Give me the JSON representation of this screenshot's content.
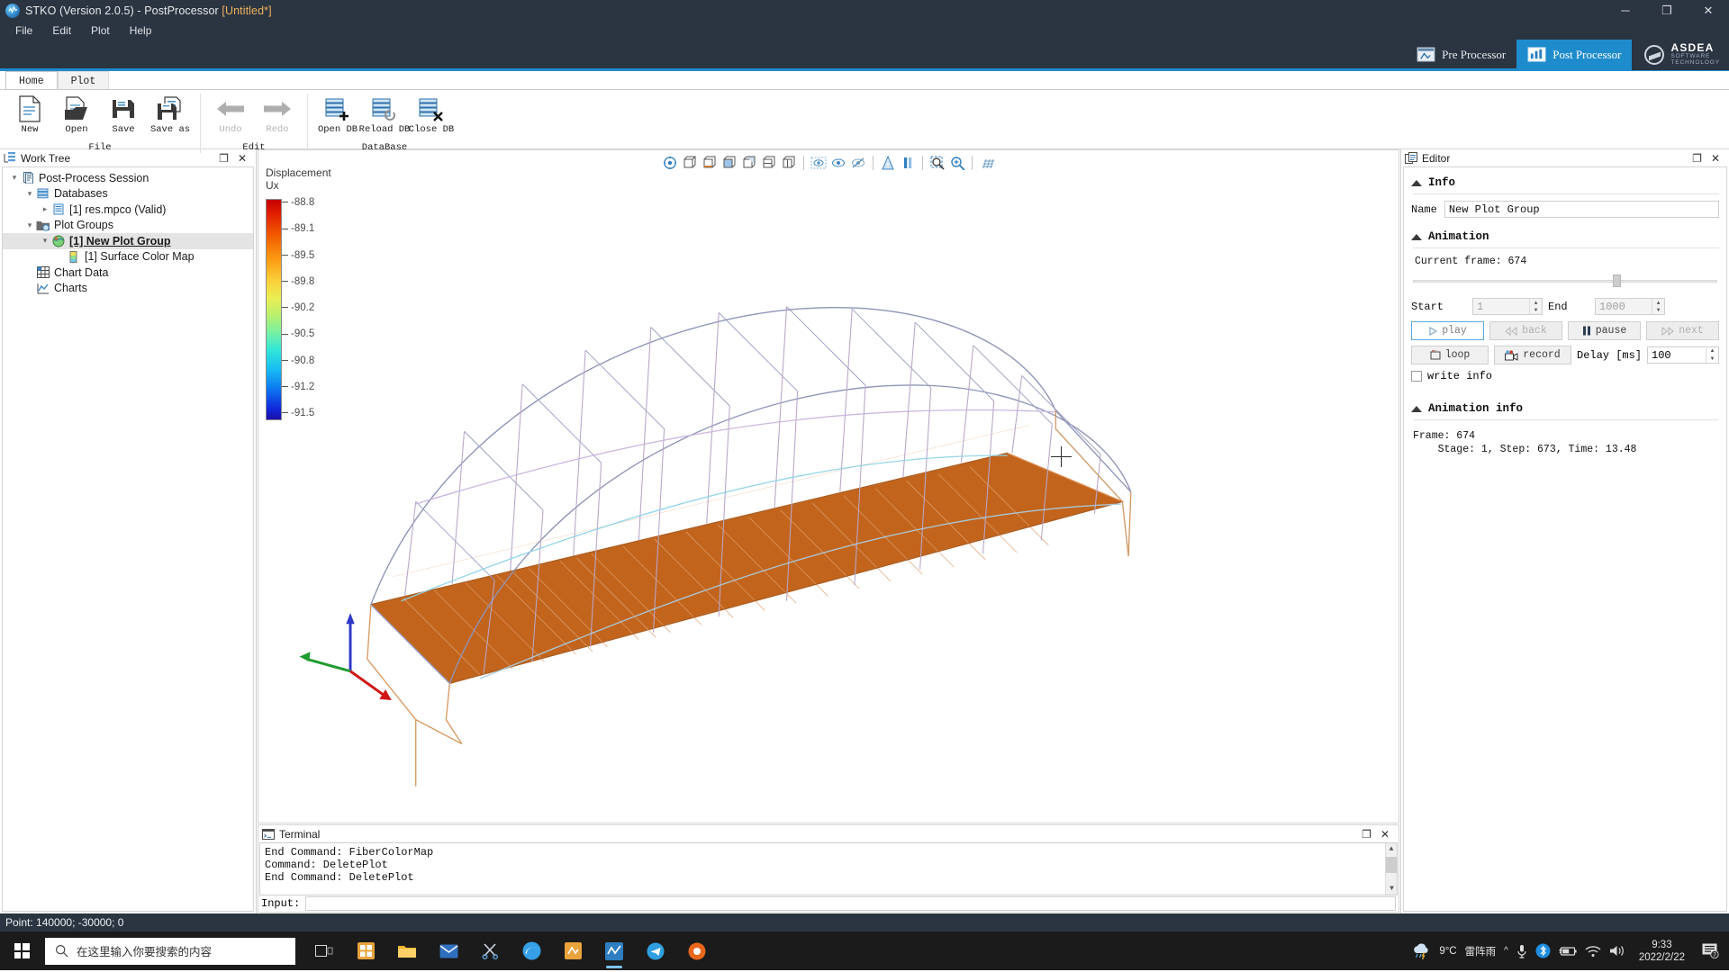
{
  "window": {
    "title_app": "STKO (Version 2.0.5) - PostProcessor ",
    "title_doc": "[Untitled*]",
    "minimize": "─",
    "maximize": "❐",
    "close": "✕"
  },
  "menubar": {
    "items": [
      "File",
      "Edit",
      "Plot",
      "Help"
    ]
  },
  "processor": {
    "pre_label": "Pre Processor",
    "post_label": "Post Processor",
    "brand_line1": "ASDEA",
    "brand_line2": "SOFTWARE\nTECHNOLOGY",
    "brand_l2a": "SOFTWARE",
    "brand_l2b": "TECHNOLOGY",
    "accent": "#1e8bcd"
  },
  "ribbon": {
    "tabs": [
      {
        "label": "Home",
        "active": true
      },
      {
        "label": "Plot",
        "active": false
      }
    ],
    "groups": [
      {
        "name": "File",
        "items": [
          {
            "label": "New",
            "icon": "new-document-icon",
            "disabled": false
          },
          {
            "label": "Open",
            "icon": "open-folder-icon",
            "disabled": false
          },
          {
            "label": "Save",
            "icon": "floppy-save-icon",
            "disabled": false
          },
          {
            "label": "Save as",
            "icon": "floppy-save-as-icon",
            "disabled": false
          }
        ]
      },
      {
        "name": "Edit",
        "items": [
          {
            "label": "Undo",
            "icon": "undo-arrow-icon",
            "disabled": true
          },
          {
            "label": "Redo",
            "icon": "redo-arrow-icon",
            "disabled": true
          }
        ]
      },
      {
        "name": "DataBase",
        "items": [
          {
            "label": "Open DB",
            "icon": "database-add-icon",
            "disabled": false
          },
          {
            "label": "Reload DB",
            "icon": "database-reload-icon",
            "disabled": false
          },
          {
            "label": "Close DB",
            "icon": "database-close-icon",
            "disabled": false
          }
        ]
      }
    ]
  },
  "worktree": {
    "title": "Work Tree",
    "float_icon": "restore-icon",
    "close_icon": "close-icon",
    "nodes": [
      {
        "label": "Post-Process Session",
        "depth": 0,
        "arrow": "⌄",
        "icon": "session-icon",
        "selected": false
      },
      {
        "label": "Databases",
        "depth": 1,
        "arrow": "⌄",
        "icon": "databases-icon",
        "selected": false
      },
      {
        "label": "[1] res.mpco (Valid)",
        "depth": 2,
        "arrow": "›",
        "icon": "database-file-icon",
        "selected": false
      },
      {
        "label": "Plot Groups",
        "depth": 1,
        "arrow": "⌄",
        "icon": "plot-groups-folder-icon",
        "selected": false
      },
      {
        "label": "[1] New Plot Group",
        "depth": 2,
        "arrow": "⌄",
        "icon": "plot-group-icon",
        "selected": true
      },
      {
        "label": "[1] Surface Color Map",
        "depth": 3,
        "arrow": "",
        "icon": "color-map-icon",
        "selected": false
      },
      {
        "label": "Chart Data",
        "depth": 1,
        "arrow": "",
        "icon": "chart-data-icon",
        "selected": false
      },
      {
        "label": "Charts",
        "depth": 1,
        "arrow": "",
        "icon": "charts-icon",
        "selected": false
      }
    ]
  },
  "viewport": {
    "toolbar_icons": [
      "isometric-view-icon",
      "view-front-icon",
      "view-back-icon",
      "view-top-icon",
      "view-bottom-icon",
      "view-left-icon",
      "view-right-icon",
      "select-visible-icon",
      "show-all-icon",
      "hide-icon",
      "perspective-icon",
      "parallel-icon",
      "zoom-box-icon",
      "zoom-fit-icon",
      "grid-icon"
    ],
    "legend": {
      "title_line1": "Displacement",
      "title_line2": "Ux",
      "ticks": [
        "-88.8",
        "-89.1",
        "-89.5",
        "-89.8",
        "-90.2",
        "-90.5",
        "-90.8",
        "-91.2",
        "-91.5"
      ]
    },
    "triad": {
      "x": "X",
      "y": "Y",
      "z": "Z"
    }
  },
  "terminal": {
    "title": "Terminal",
    "lines": [
      "End Command: FiberColorMap",
      "Command: DeletePlot",
      "End Command: DeletePlot"
    ],
    "input_label": "Input:",
    "input_value": ""
  },
  "editor": {
    "title": "Editor",
    "sections": {
      "info": {
        "header": "Info",
        "name_label": "Name",
        "name_value": "New Plot Group"
      },
      "animation": {
        "header": "Animation",
        "current_frame_label": "Current frame: 674",
        "slider_percent": 67,
        "start_label": "Start",
        "start_value": "1",
        "end_label": "End",
        "end_value": "1000",
        "play_label": "play",
        "back_label": "back",
        "pause_label": "pause",
        "next_label": "next",
        "loop_label": "loop",
        "record_label": "record",
        "delay_label": "Delay [ms]",
        "delay_value": "100",
        "write_info_label": "write info"
      },
      "animation_info": {
        "header": "Animation info",
        "line1": "Frame: 674",
        "line2": "    Stage: 1, Step: 673, Time: 13.48"
      }
    }
  },
  "statusbar": {
    "text": "Point: 140000; -30000; 0"
  },
  "taskbar": {
    "search_placeholder": "在这里输入你要搜索的内容",
    "apps": [
      "task-view-icon",
      "store-icon",
      "file-explorer-icon",
      "mail-icon",
      "scissors-icon",
      "edge-icon",
      "snipaste-icon",
      "stko-app-icon",
      "telegram-icon",
      "browser-icon"
    ],
    "weather_temp": "9°C",
    "weather_text": "雷阵雨",
    "time": "9:33",
    "date": "2022/2/22",
    "notification_count": "7"
  }
}
